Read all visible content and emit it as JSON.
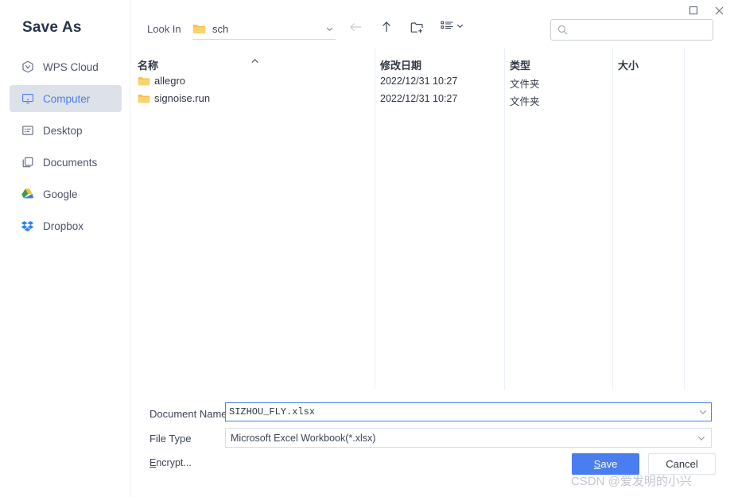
{
  "window": {
    "maximize_icon": "maximize-icon",
    "close_icon": "close-icon"
  },
  "sidebar": {
    "title": "Save As",
    "items": [
      {
        "label": "WPS Cloud",
        "icon": "cloud-hexagon-icon",
        "active": false
      },
      {
        "label": "Computer",
        "icon": "monitor-icon",
        "active": true
      },
      {
        "label": "Desktop",
        "icon": "desktop-window-icon",
        "active": false
      },
      {
        "label": "Documents",
        "icon": "documents-folder-icon",
        "active": false
      },
      {
        "label": "Google",
        "icon": "google-drive-icon",
        "active": false
      },
      {
        "label": "Dropbox",
        "icon": "dropbox-icon",
        "active": false
      }
    ]
  },
  "toolbar": {
    "look_in_label": "Look In",
    "current_folder": "sch",
    "folder_icon": "folder-icon",
    "dropdown_icon": "chevron-down-icon",
    "back_icon": "arrow-left-icon",
    "up_icon": "arrow-up-icon",
    "new_folder_icon": "new-folder-icon",
    "view_mode_icon": "list-view-icon",
    "view_mode_caret_icon": "chevron-down-icon"
  },
  "search": {
    "icon": "search-icon",
    "value": "",
    "placeholder": ""
  },
  "file_list": {
    "columns": [
      "名称",
      "修改日期",
      "类型",
      "大小"
    ],
    "sort_indicator_icon": "chevron-up-icon",
    "rows": [
      {
        "name": "allegro",
        "icon": "folder-icon",
        "modified": "2022/12/31 10:27",
        "type": "文件夹",
        "size": ""
      },
      {
        "name": "signoise.run",
        "icon": "folder-icon",
        "modified": "2022/12/31 10:27",
        "type": "文件夹",
        "size": ""
      }
    ]
  },
  "form": {
    "document_name_label": "Document Name",
    "document_name_value": "SIZHOU_FLY.xlsx",
    "document_name_caret_icon": "chevron-down-icon",
    "file_type_label": "File Type",
    "file_type_value": "Microsoft Excel Workbook(*.xlsx)",
    "file_type_caret_icon": "chevron-down-icon",
    "encrypt_label_accel": "E",
    "encrypt_label_rest": "ncrypt...",
    "save_accel": "S",
    "save_rest": "ave",
    "cancel_label": "Cancel"
  },
  "watermark": {
    "text": "CSDN @爱发明的小兴"
  },
  "colors": {
    "accent": "#4a7df0",
    "title": "#26344d",
    "selected_bg": "#dde1e9",
    "folder_yellow": "#f7c14b"
  }
}
